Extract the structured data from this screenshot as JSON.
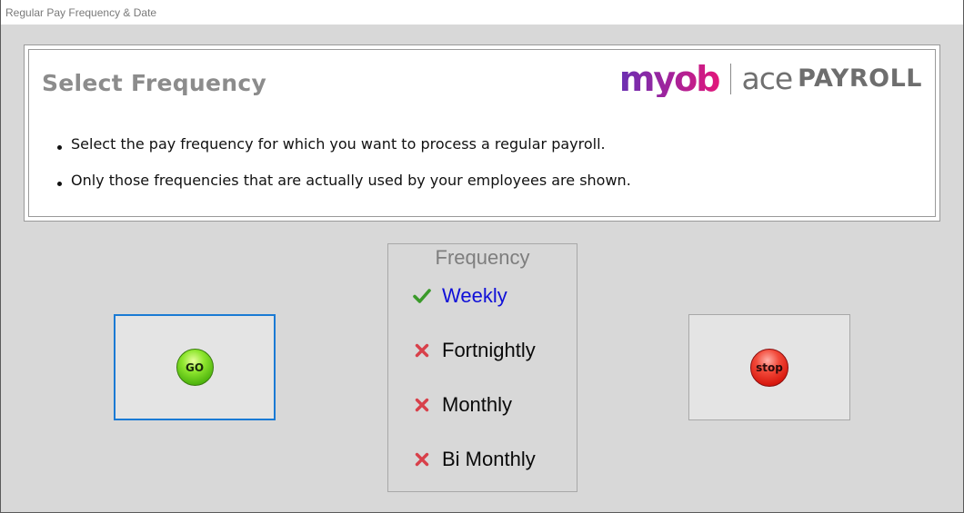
{
  "window": {
    "title": "Regular Pay Frequency & Date"
  },
  "header": {
    "title": "Select Frequency",
    "logo": {
      "brand": "myob",
      "product_prefix": "ace",
      "product_suffix": "PAYROLL",
      "brand_gradient": [
        "#6a2fb2",
        "#a2239c",
        "#e2177a"
      ]
    },
    "bullets": [
      "Select the pay frequency for which you want to process a regular payroll.",
      "Only those frequencies that are actually used by your employees are shown."
    ]
  },
  "go_button": {
    "label": "GO",
    "color": "#5cc41a",
    "focus_border": "#1a7ad4"
  },
  "stop_button": {
    "label": "stop",
    "color": "#e0261a"
  },
  "frequency": {
    "title": "Frequency",
    "items": [
      {
        "label": "Weekly",
        "icon": "check-icon",
        "available": true,
        "selected": true
      },
      {
        "label": "Fortnightly",
        "icon": "cross-icon",
        "available": false,
        "selected": false
      },
      {
        "label": "Monthly",
        "icon": "cross-icon",
        "available": false,
        "selected": false
      },
      {
        "label": "Bi Monthly",
        "icon": "cross-icon",
        "available": false,
        "selected": false
      }
    ],
    "selected_color": "#1010d8"
  }
}
